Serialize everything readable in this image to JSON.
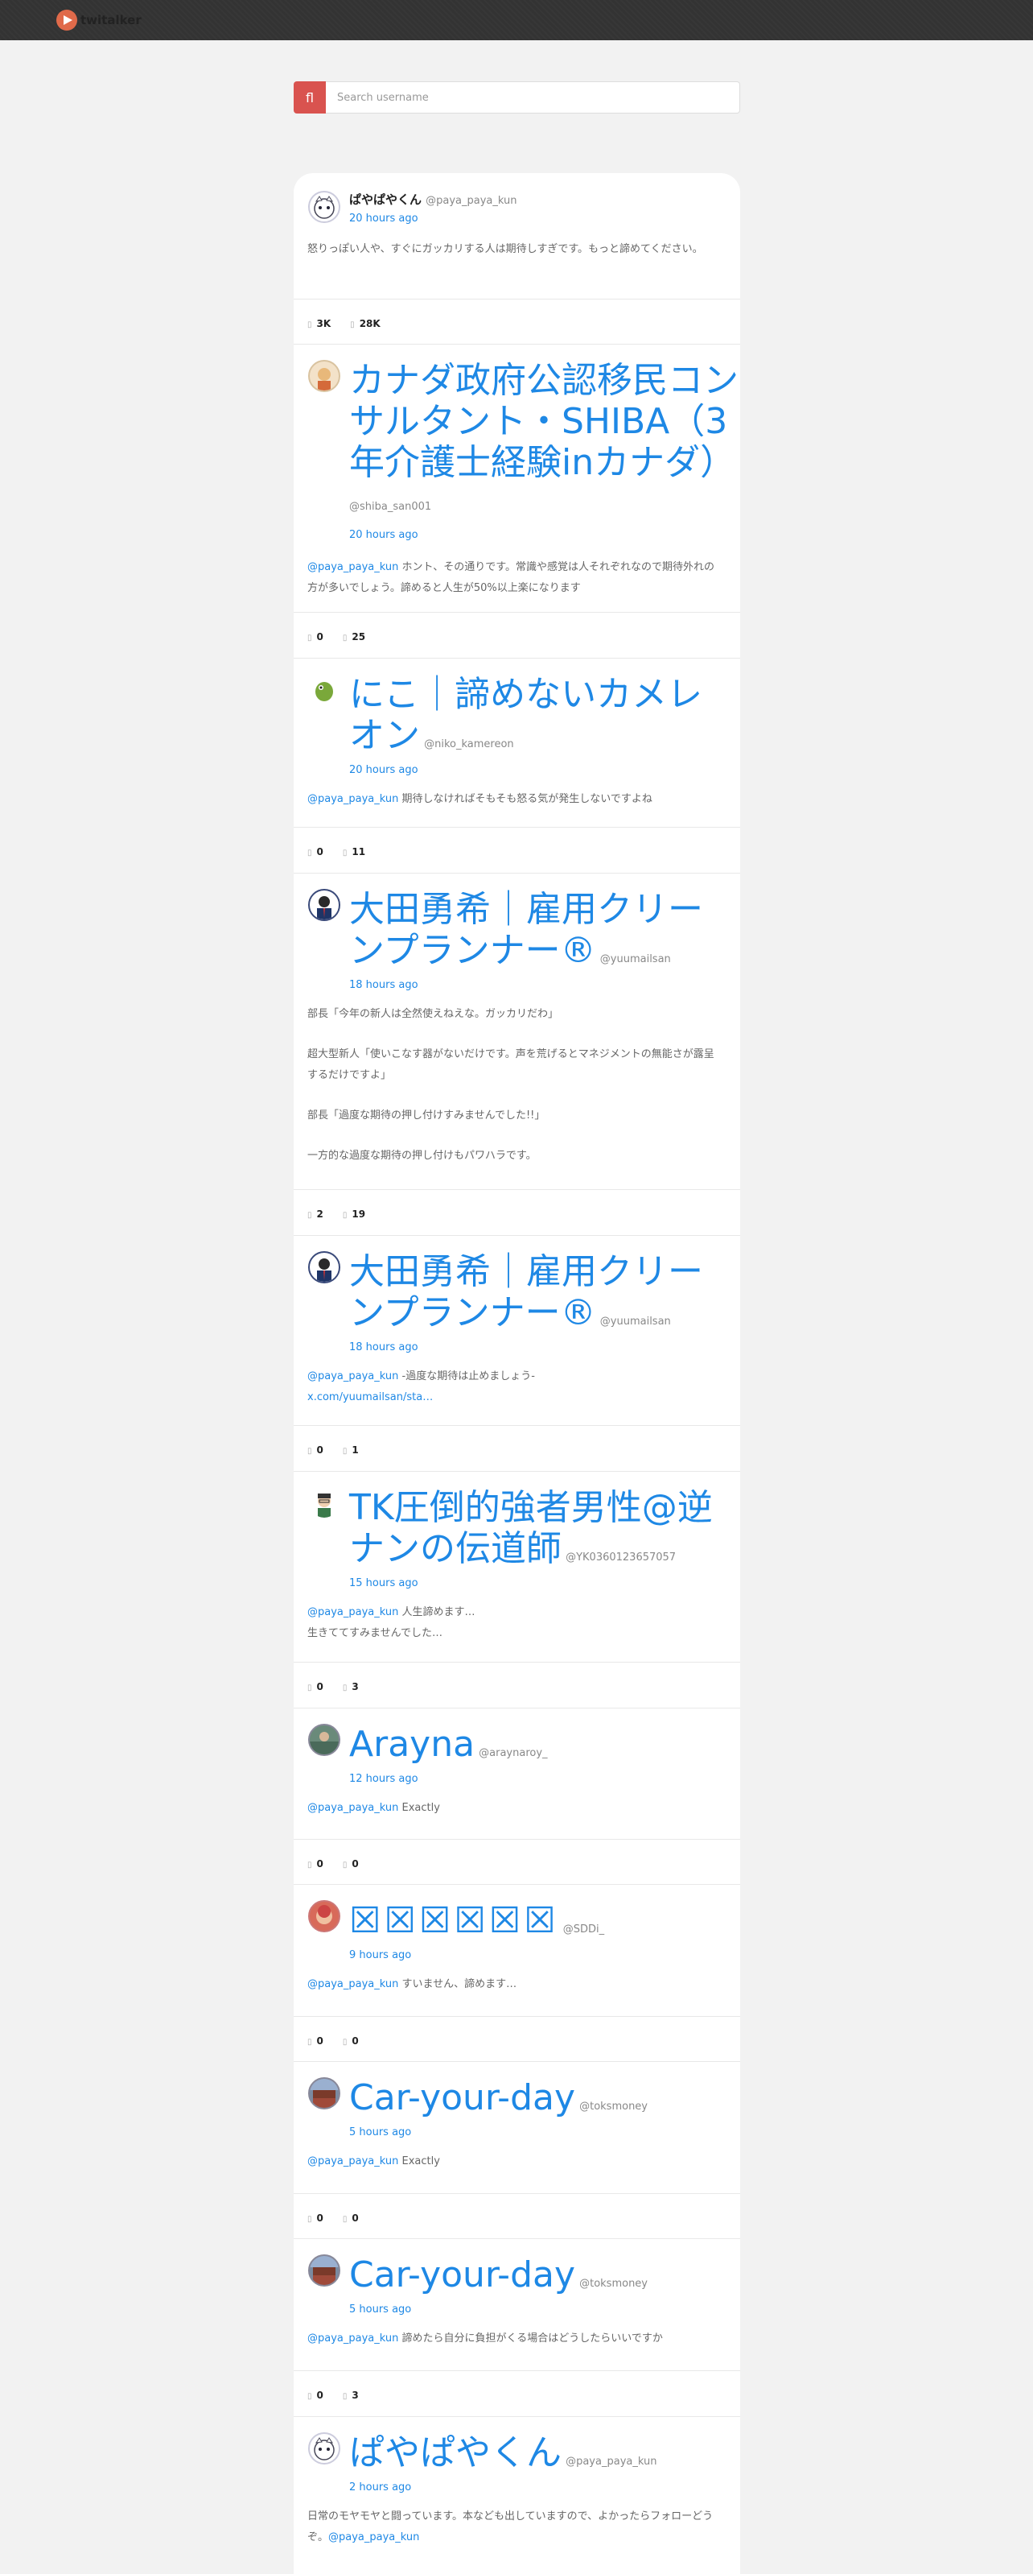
{
  "app": {
    "name": "twitalker"
  },
  "search": {
    "icon": "search-icon",
    "placeholder": "Search username",
    "button_glyph": "fl"
  },
  "tweets": [
    {
      "name": "ぱやぱやくん",
      "username": "@paya_paya_kun",
      "time": "20 hours ago",
      "text": "怒りっぽい人や、すぐにガッカリする人は期待しすぎです。もっと諦めてください。",
      "stat1": "3K",
      "stat2": "28K"
    },
    {
      "name": "カナダ政府公認移民コンサルタント・SHIBA（3年介護士経験inカナダ）",
      "username": "@shiba_san001",
      "time": "20 hours ago",
      "mention": "@paya_paya_kun",
      "text": " ホント、その通りです。常識や感覚は人それぞれなので期待外れの方が多いでしょう。諦めると人生が50%以上楽になります",
      "stat1": "0",
      "stat2": "25"
    },
    {
      "name": "にこ｜諦めないカメレオン",
      "username": "@niko_kamereon",
      "time": "20 hours ago",
      "mention": "@paya_paya_kun",
      "text": " 期待しなければそもそも怒る気が発生しないですよね",
      "stat1": "0",
      "stat2": "11"
    },
    {
      "name": "大田勇希｜雇用クリーンプランナー®",
      "username": "@yuumailsan",
      "time": "18 hours ago",
      "lines": [
        "部長「今年の新人は全然使えねえな。ガッカリだわ」",
        "超大型新人「使いこなす器がないだけです。声を荒げるとマネジメントの無能さが露呈するだけですよ」",
        "部長「過度な期待の押し付けすみませんでした!!」",
        "一方的な過度な期待の押し付けもパワハラです。"
      ],
      "stat1": "2",
      "stat2": "19"
    },
    {
      "name": "大田勇希｜雇用クリーンプランナー®",
      "username": "@yuumailsan",
      "time": "18 hours ago",
      "mention": "@paya_paya_kun",
      "text": " -過度な期待は止めましょう-",
      "link": "x.com/yuumailsan/sta…",
      "stat1": "0",
      "stat2": "1"
    },
    {
      "name": "TK圧倒的強者男性@逆ナンの伝道師",
      "username": "@YK0360123657057",
      "time": "15 hours ago",
      "mention": "@paya_paya_kun",
      "text": " 人生諦めます…",
      "text2": "生きててすみませんでした…",
      "stat1": "0",
      "stat2": "3"
    },
    {
      "name": "Arayna",
      "username": "@araynaroy_",
      "time": "12 hours ago",
      "mention": "@paya_paya_kun",
      "text": " Exactly",
      "stat1": "0",
      "stat2": "0"
    },
    {
      "name": "☒☒☒☒☒☒",
      "username": "@SDDi_",
      "time": "9 hours ago",
      "mention": "@paya_paya_kun",
      "text": " すいません、諦めます…",
      "stat1": "0",
      "stat2": "0"
    },
    {
      "name": "Car-your-day",
      "username": "@toksmoney",
      "time": "5 hours ago",
      "mention": "@paya_paya_kun",
      "text": " Exactly",
      "stat1": "0",
      "stat2": "0"
    },
    {
      "name": "Car-your-day",
      "username": "@toksmoney",
      "time": "5 hours ago",
      "mention": "@paya_paya_kun",
      "text": " 諦めたら自分に負担がくる場合はどうしたらいいですか",
      "stat1": "0",
      "stat2": "3"
    },
    {
      "name": "ぱやぱやくん",
      "username": "@paya_paya_kun",
      "time": "2 hours ago",
      "text": "日常のモヤモヤと闘っています。本なども出していますので、よかったらフォローどうぞ。",
      "mention": "@paya_paya_kun"
    }
  ],
  "icons": {
    "retweet": "retweet-icon",
    "like": "like-icon"
  },
  "colors": {
    "accent": "#1e88e5",
    "search_button": "#d9534f",
    "topbar": "#333333"
  }
}
